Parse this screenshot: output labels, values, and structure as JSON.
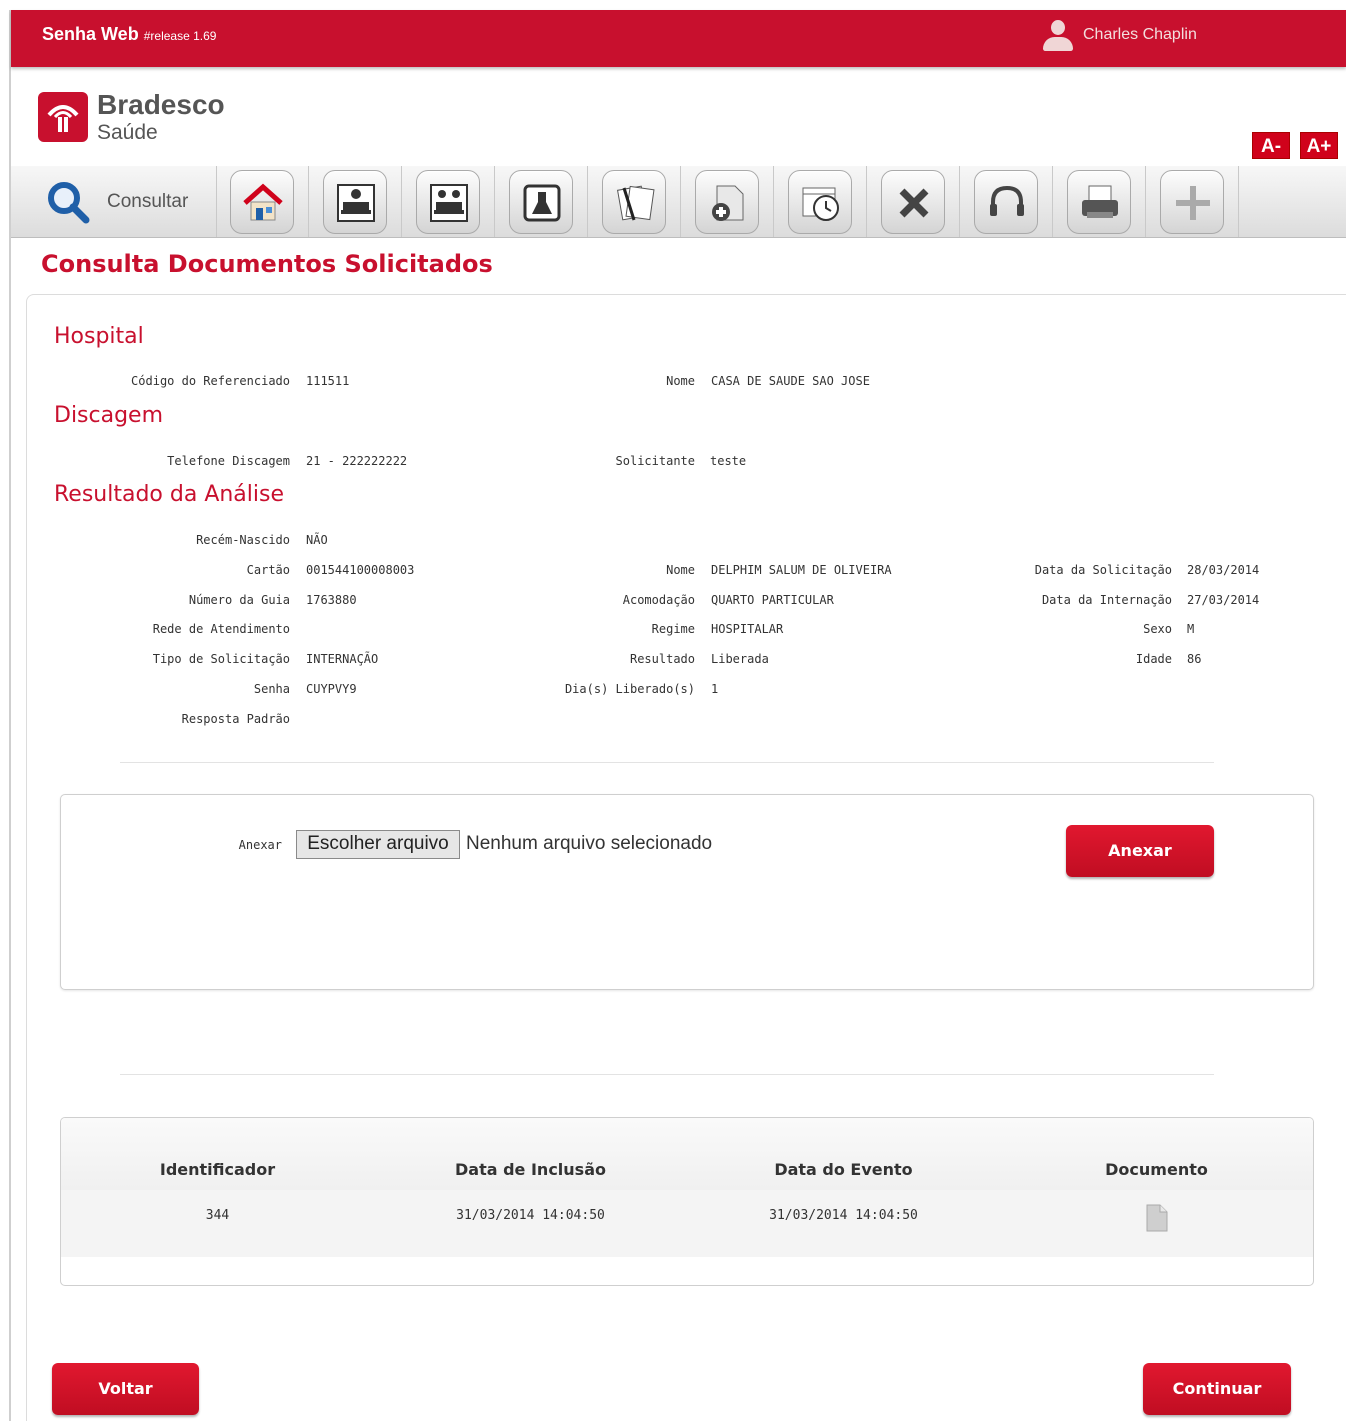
{
  "header": {
    "app_name": "Senha Web",
    "release": "#release 1.69",
    "user_name": "Charles Chaplin"
  },
  "logo": {
    "title": "Bradesco",
    "subtitle": "Saúde"
  },
  "font_controls": {
    "decrease": "A-",
    "increase": "A+"
  },
  "toolbar": {
    "consultar_label": "Consultar",
    "icons": [
      "home-icon",
      "patient-bed-icon",
      "patients-bed-icon",
      "lab-flask-icon",
      "documents-pen-icon",
      "document-add-icon",
      "calendar-clock-icon",
      "close-x-icon",
      "headset-icon",
      "printer-icon",
      "plus-icon"
    ]
  },
  "page": {
    "title": "Consulta Documentos Solicitados"
  },
  "hospital": {
    "section_title": "Hospital",
    "codigo_label": "Código do Referenciado",
    "codigo_value": "111511",
    "nome_label": "Nome",
    "nome_value": "CASA DE SAUDE SAO JOSE"
  },
  "discagem": {
    "section_title": "Discagem",
    "telefone_label": "Telefone Discagem",
    "telefone_value": "21 - 222222222",
    "solicitante_label": "Solicitante",
    "solicitante_value": "teste"
  },
  "resultado": {
    "section_title": "Resultado da Análise",
    "recem_label": "Recém-Nascido",
    "recem_value": "NÃO",
    "cartao_label": "Cartão",
    "cartao_value": "001544100008003",
    "guia_label": "Número da Guia",
    "guia_value": "1763880",
    "rede_label": "Rede de Atendimento",
    "rede_value": "",
    "tipo_label": "Tipo de Solicitação",
    "tipo_value": "INTERNAÇÃO",
    "senha_label": "Senha",
    "senha_value": "CUYPVY9",
    "resposta_label": "Resposta Padrão",
    "resposta_value": "",
    "nome_label": "Nome",
    "nome_value": "DELPHIM SALUM DE OLIVEIRA",
    "acomodacao_label": "Acomodação",
    "acomodacao_value": "QUARTO PARTICULAR",
    "regime_label": "Regime",
    "regime_value": "HOSPITALAR",
    "resultado_label": "Resultado",
    "resultado_value": "Liberada",
    "dias_label": "Dia(s) Liberado(s)",
    "dias_value": "1",
    "data_solic_label": "Data da Solicitação",
    "data_solic_value": "28/03/2014",
    "data_intern_label": "Data da Internação",
    "data_intern_value": "27/03/2014",
    "sexo_label": "Sexo",
    "sexo_value": "M",
    "idade_label": "Idade",
    "idade_value": "86"
  },
  "attach": {
    "label": "Anexar",
    "file_button": "Escolher arquivo",
    "file_status": "Nenhum arquivo selecionado",
    "submit_label": "Anexar"
  },
  "table": {
    "headers": [
      "Identificador",
      "Data de Inclusão",
      "Data do Evento",
      "Documento"
    ],
    "rows": [
      {
        "id": "344",
        "inclusao": "31/03/2014 14:04:50",
        "evento": "31/03/2014 14:04:50"
      }
    ]
  },
  "footer": {
    "back_label": "Voltar",
    "continue_label": "Continuar"
  },
  "colors": {
    "brand_red": "#c8102e"
  }
}
